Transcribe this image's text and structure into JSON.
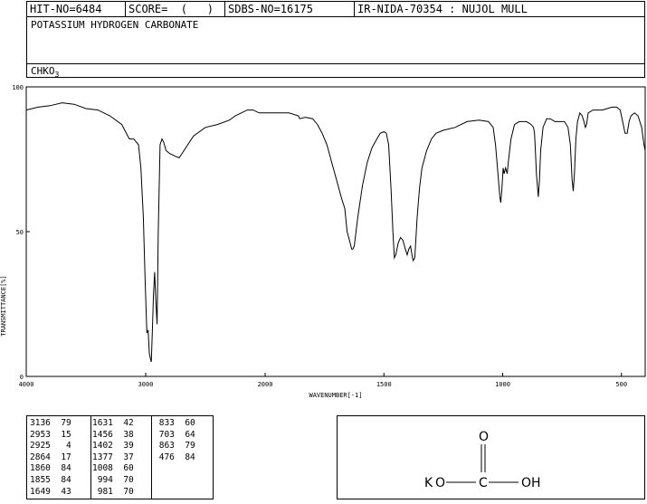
{
  "header": {
    "hit_no": "HIT-NO=6484",
    "score": "SCORE=  (   )",
    "sdbs_no": "SDBS-NO=16175",
    "ir_code": "IR-NIDA-70354 : NUJOL MULL",
    "compound_name": "POTASSIUM HYDROGEN CARBONATE",
    "formula_main": "CHKO",
    "formula_sub": "3"
  },
  "chart_data": {
    "type": "line",
    "title": "",
    "xlabel": "WAVENUMBER[-1]",
    "ylabel": "TRANSMITTANCE[%]",
    "xlim": [
      4000,
      400
    ],
    "ylim": [
      0,
      100
    ],
    "x_ticks": [
      "4000",
      "3000",
      "2000",
      "1500",
      "1000",
      "500"
    ],
    "x_tick_values": [
      4000,
      3000,
      2000,
      1500,
      1000,
      500
    ],
    "y_ticks": [
      "0",
      "50",
      "100"
    ],
    "y_tick_values": [
      0,
      50,
      100
    ],
    "grid": false,
    "series": [
      {
        "name": "",
        "points": [
          [
            4000,
            92
          ],
          [
            3900,
            93
          ],
          [
            3800,
            93.5
          ],
          [
            3700,
            94.5
          ],
          [
            3600,
            94
          ],
          [
            3500,
            92.5
          ],
          [
            3400,
            92
          ],
          [
            3300,
            90
          ],
          [
            3200,
            87
          ],
          [
            3150,
            83
          ],
          [
            3136,
            82
          ],
          [
            3100,
            82
          ],
          [
            3060,
            80
          ],
          [
            3040,
            72
          ],
          [
            3020,
            55
          ],
          [
            3005,
            33
          ],
          [
            2990,
            15
          ],
          [
            2980,
            16
          ],
          [
            2970,
            8
          ],
          [
            2960,
            6
          ],
          [
            2953,
            5
          ],
          [
            2945,
            15
          ],
          [
            2935,
            28
          ],
          [
            2925,
            36
          ],
          [
            2915,
            26
          ],
          [
            2905,
            18
          ],
          [
            2895,
            50
          ],
          [
            2880,
            80
          ],
          [
            2864,
            82
          ],
          [
            2850,
            81
          ],
          [
            2830,
            78
          ],
          [
            2800,
            77
          ],
          [
            2750,
            76
          ],
          [
            2720,
            75.5
          ],
          [
            2680,
            78
          ],
          [
            2600,
            83
          ],
          [
            2500,
            86
          ],
          [
            2400,
            87
          ],
          [
            2300,
            88.5
          ],
          [
            2250,
            90
          ],
          [
            2200,
            91
          ],
          [
            2150,
            92
          ],
          [
            2100,
            92
          ],
          [
            2050,
            91
          ],
          [
            2000,
            91
          ],
          [
            1950,
            91
          ],
          [
            1900,
            91
          ],
          [
            1860,
            90
          ],
          [
            1855,
            89
          ],
          [
            1830,
            89.5
          ],
          [
            1800,
            89
          ],
          [
            1780,
            87
          ],
          [
            1760,
            84
          ],
          [
            1740,
            80
          ],
          [
            1720,
            74
          ],
          [
            1700,
            68
          ],
          [
            1680,
            62
          ],
          [
            1665,
            58
          ],
          [
            1655,
            50
          ],
          [
            1645,
            47
          ],
          [
            1636,
            44
          ],
          [
            1631,
            44
          ],
          [
            1625,
            45
          ],
          [
            1610,
            55
          ],
          [
            1590,
            66
          ],
          [
            1570,
            74
          ],
          [
            1550,
            79
          ],
          [
            1530,
            82
          ],
          [
            1515,
            84
          ],
          [
            1500,
            84.5
          ],
          [
            1490,
            84
          ],
          [
            1480,
            80
          ],
          [
            1470,
            65
          ],
          [
            1462,
            50
          ],
          [
            1456,
            41
          ],
          [
            1450,
            42
          ],
          [
            1440,
            46
          ],
          [
            1430,
            48
          ],
          [
            1420,
            47
          ],
          [
            1410,
            44
          ],
          [
            1402,
            42
          ],
          [
            1395,
            44
          ],
          [
            1388,
            45
          ],
          [
            1380,
            41
          ],
          [
            1377,
            40
          ],
          [
            1370,
            41
          ],
          [
            1360,
            55
          ],
          [
            1350,
            65
          ],
          [
            1340,
            72
          ],
          [
            1320,
            78
          ],
          [
            1300,
            82
          ],
          [
            1280,
            84
          ],
          [
            1250,
            85
          ],
          [
            1200,
            86
          ],
          [
            1150,
            88
          ],
          [
            1100,
            88.5
          ],
          [
            1060,
            88
          ],
          [
            1040,
            86
          ],
          [
            1030,
            80
          ],
          [
            1020,
            70
          ],
          [
            1012,
            62
          ],
          [
            1008,
            60
          ],
          [
            1003,
            65
          ],
          [
            998,
            72
          ],
          [
            994,
            70
          ],
          [
            988,
            72
          ],
          [
            981,
            70
          ],
          [
            975,
            75
          ],
          [
            965,
            82
          ],
          [
            950,
            87
          ],
          [
            930,
            88
          ],
          [
            900,
            88
          ],
          [
            880,
            87
          ],
          [
            870,
            86
          ],
          [
            866,
            84
          ],
          [
            863,
            79
          ],
          [
            858,
            70
          ],
          [
            850,
            62
          ],
          [
            845,
            68
          ],
          [
            840,
            78
          ],
          [
            830,
            86
          ],
          [
            815,
            89
          ],
          [
            800,
            89
          ],
          [
            780,
            88
          ],
          [
            760,
            88
          ],
          [
            740,
            88
          ],
          [
            725,
            86
          ],
          [
            715,
            80
          ],
          [
            708,
            68
          ],
          [
            703,
            64
          ],
          [
            698,
            70
          ],
          [
            692,
            82
          ],
          [
            685,
            88
          ],
          [
            675,
            91
          ],
          [
            665,
            90
          ],
          [
            658,
            88
          ],
          [
            652,
            86
          ],
          [
            647,
            87
          ],
          [
            640,
            91
          ],
          [
            620,
            92
          ],
          [
            600,
            92
          ],
          [
            580,
            92
          ],
          [
            560,
            92.5
          ],
          [
            540,
            93
          ],
          [
            520,
            93
          ],
          [
            505,
            92
          ],
          [
            495,
            88
          ],
          [
            485,
            84
          ],
          [
            476,
            84
          ],
          [
            468,
            88
          ],
          [
            460,
            90
          ],
          [
            445,
            91
          ],
          [
            430,
            90
          ],
          [
            415,
            86
          ],
          [
            405,
            80
          ],
          [
            400,
            78
          ]
        ]
      }
    ]
  },
  "peak_table": {
    "columns": [
      [
        [
          "3136",
          "79"
        ],
        [
          "2953",
          "15"
        ],
        [
          "2925",
          "4"
        ],
        [
          "2864",
          "17"
        ],
        [
          "1860",
          "84"
        ],
        [
          "1855",
          "84"
        ],
        [
          "1649",
          "43"
        ]
      ],
      [
        [
          "1631",
          "42"
        ],
        [
          "1456",
          "38"
        ],
        [
          "1402",
          "39"
        ],
        [
          "1377",
          "37"
        ],
        [
          "1008",
          "60"
        ],
        [
          "994",
          "70"
        ],
        [
          "981",
          "70"
        ]
      ],
      [
        [
          "833",
          "60"
        ],
        [
          "703",
          "64"
        ],
        [
          "863",
          "79"
        ],
        [
          "476",
          "84"
        ]
      ]
    ]
  },
  "structure": {
    "atom_k": "K",
    "atom_o_left": "O",
    "atom_c": "C",
    "atom_o_top": "O",
    "atom_oh": "OH"
  }
}
